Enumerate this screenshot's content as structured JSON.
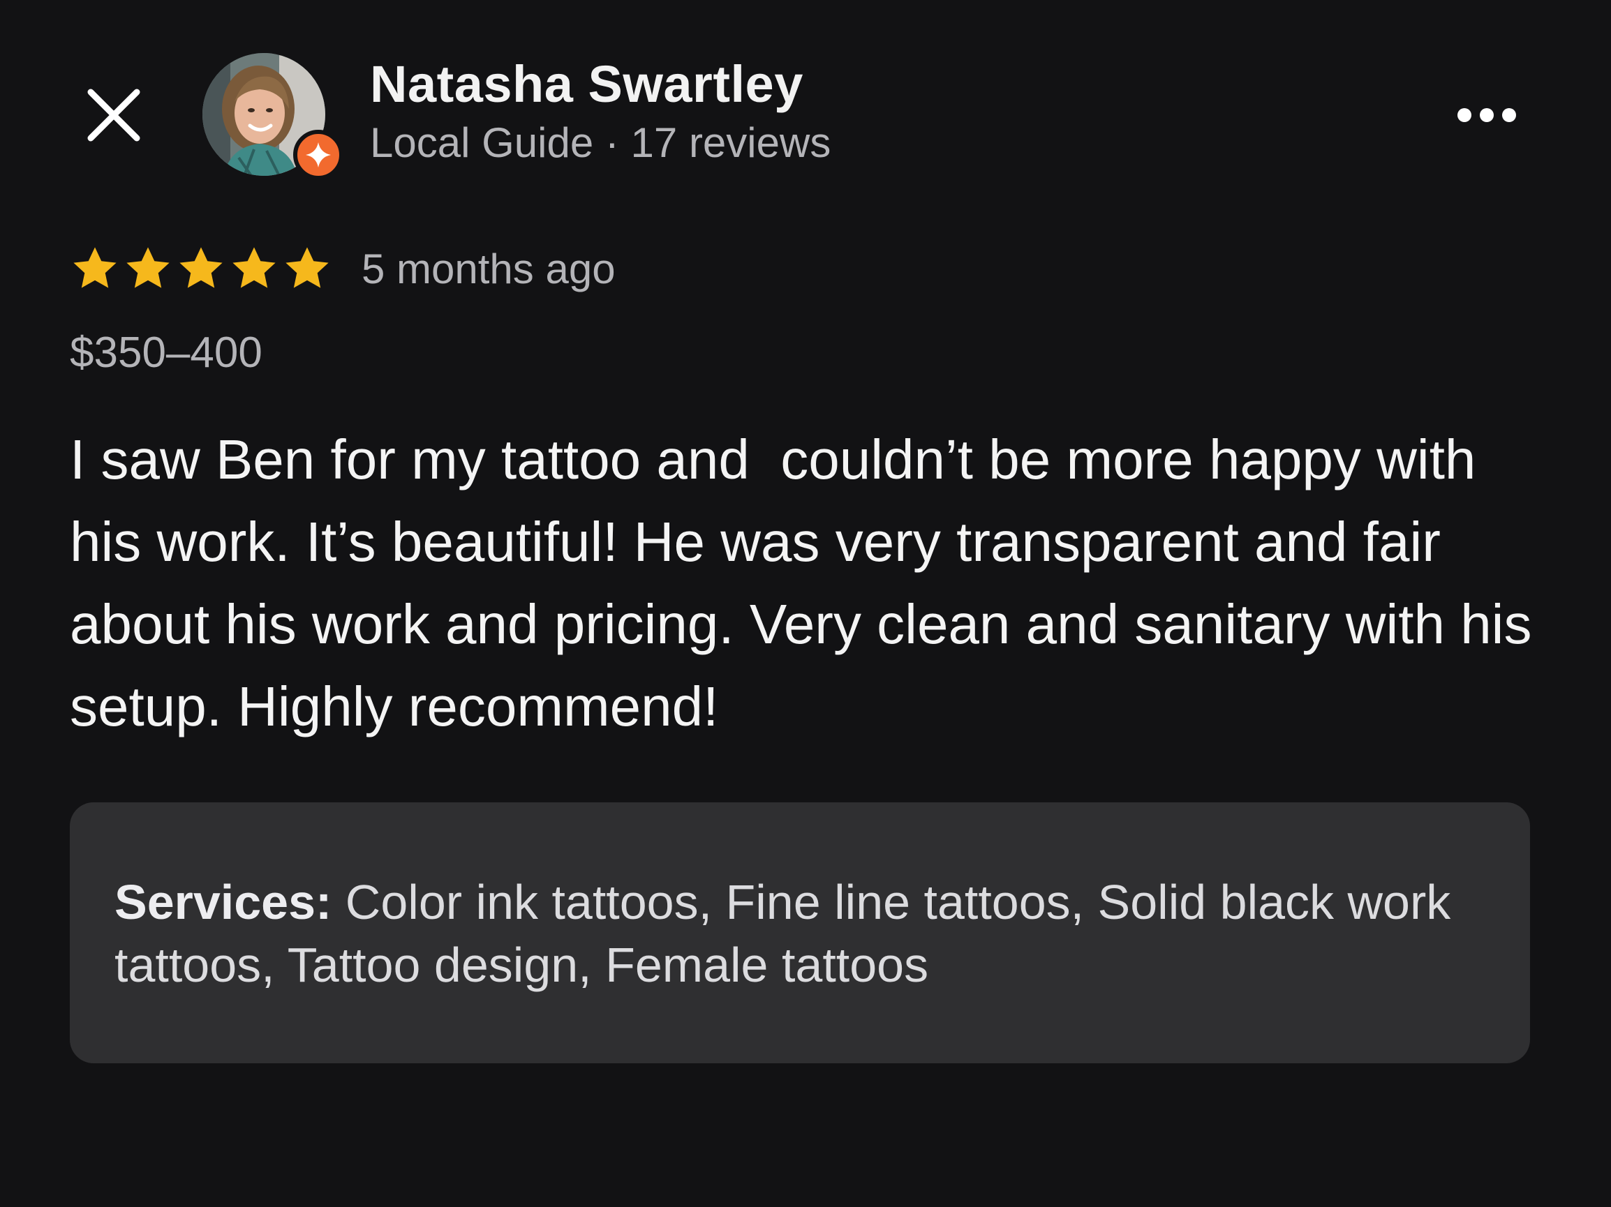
{
  "header": {
    "close_icon": "close-icon",
    "more_icon": "more-horizontal-icon"
  },
  "reviewer": {
    "name": "Natasha Swartley",
    "meta": "Local Guide · 17 reviews",
    "badge_icon": "local-guide-star-icon",
    "badge_color": "#f26a2e"
  },
  "review": {
    "rating": 5,
    "rating_max": 5,
    "star_color": "#f6b81c",
    "time": "5 months ago",
    "price": "$350–400",
    "text": "I saw Ben for my tattoo and  couldn’t be more happy with his work. It’s beautiful! He was very transparent and fair about his work and pricing. Very clean and sanitary with his setup. Highly recommend!"
  },
  "services": {
    "label": "Services:",
    "value": " Color ink tattoos, Fine line tattoos, Solid black work tattoos, Tattoo design, Female tattoos"
  }
}
